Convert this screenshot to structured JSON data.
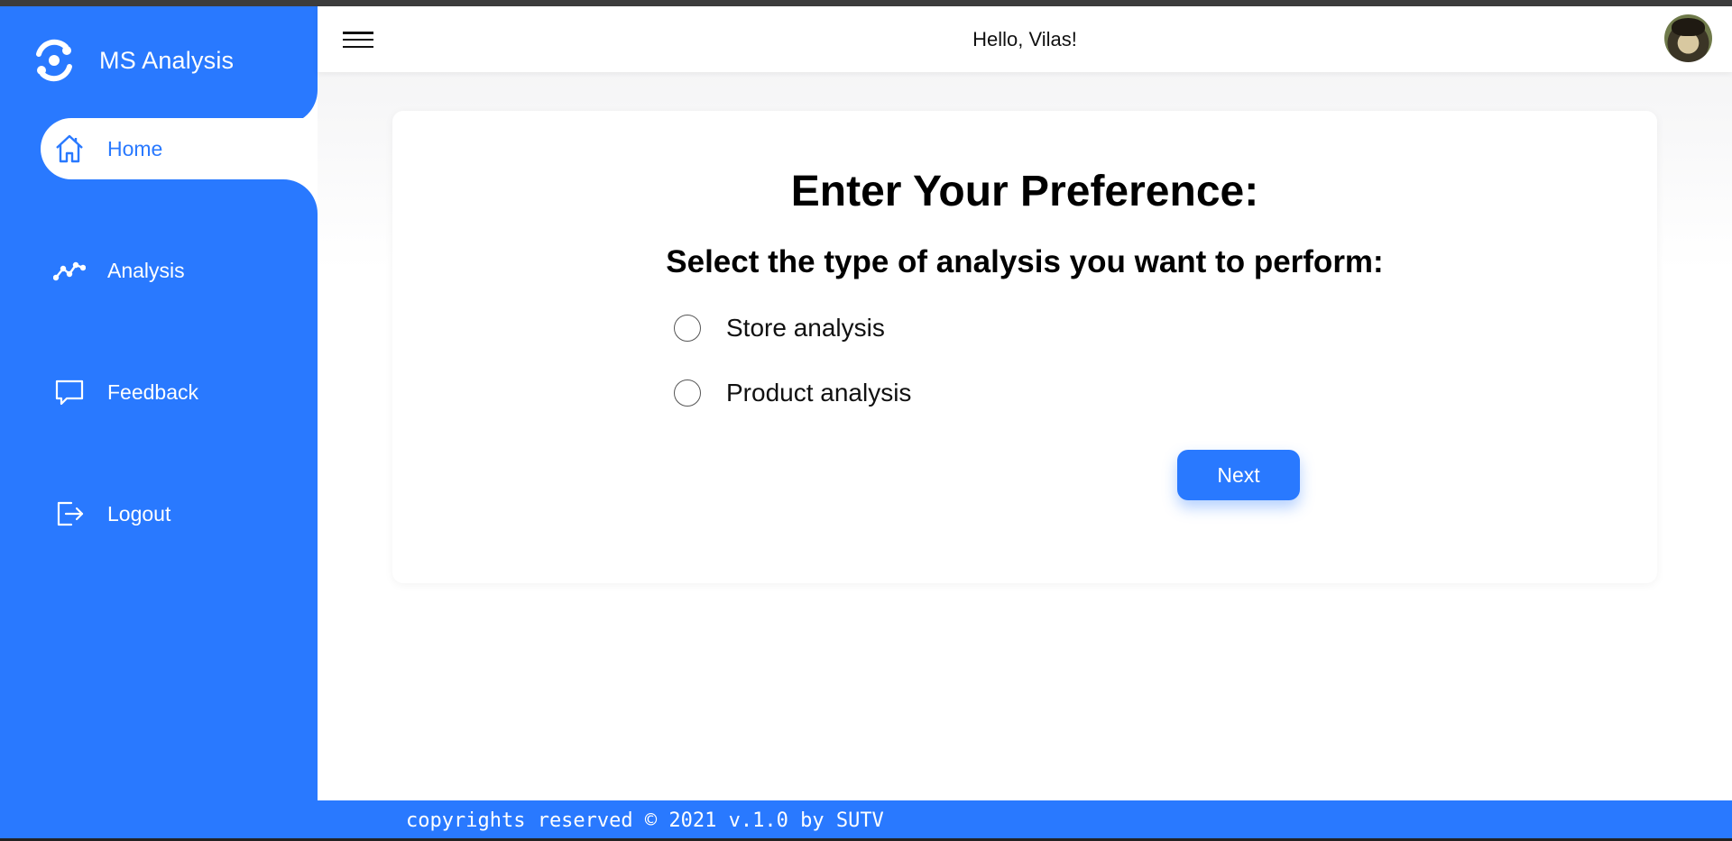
{
  "app": {
    "name": "MS Analysis"
  },
  "sidebar": {
    "items": [
      {
        "label": "Home",
        "icon": "home-icon",
        "active": true
      },
      {
        "label": "Analysis",
        "icon": "line-chart-icon",
        "active": false
      },
      {
        "label": "Feedback",
        "icon": "chat-bubble-icon",
        "active": false
      },
      {
        "label": "Logout",
        "icon": "logout-icon",
        "active": false
      }
    ]
  },
  "header": {
    "greeting": "Hello, Vilas!"
  },
  "card": {
    "title": "Enter Your Preference:",
    "subtitle": "Select the type of analysis you want to perform:",
    "options": [
      {
        "label": "Store analysis",
        "selected": false
      },
      {
        "label": "Product analysis",
        "selected": false
      }
    ],
    "next_label": "Next"
  },
  "footer": {
    "text": "copyrights reserved © 2021 v.1.0 by SUTV"
  },
  "colors": {
    "accent": "#2979ff",
    "background": "#ffffff",
    "text": "#000000"
  }
}
